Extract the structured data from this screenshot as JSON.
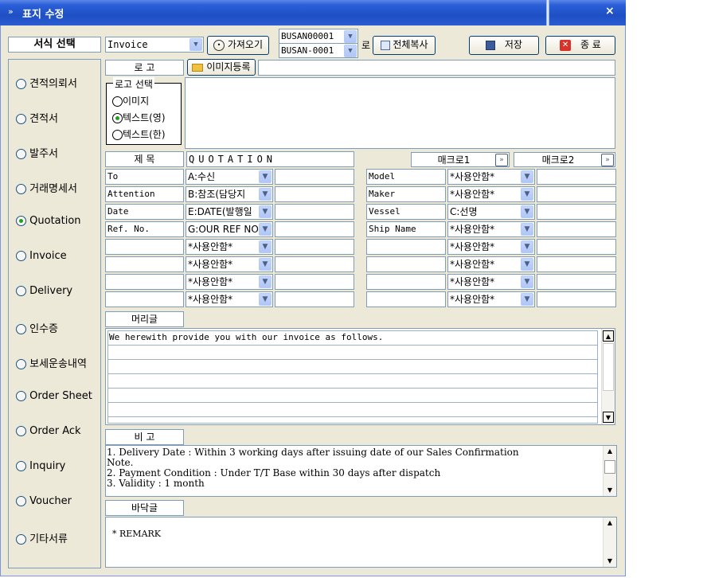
{
  "window": {
    "title": "표지 수정",
    "close": "×",
    "title_icon": "»"
  },
  "top": {
    "format_label": "서식 선택",
    "format_value": "Invoice",
    "import_button": "가져오기",
    "source_code_1": "BUSAN00001",
    "source_code_2": "BUSAN-0001",
    "to_label": "로",
    "copy_all_button": "전체복사",
    "save_button": "저장",
    "exit_button": "종 료"
  },
  "sidebar": {
    "items": [
      {
        "label": "견적의뢰서",
        "selected": false
      },
      {
        "label": "견적서",
        "selected": false
      },
      {
        "label": "발주서",
        "selected": false
      },
      {
        "label": "거래명세서",
        "selected": false
      },
      {
        "label": "Quotation",
        "selected": true
      },
      {
        "label": "Invoice",
        "selected": false
      },
      {
        "label": "Delivery",
        "selected": false
      },
      {
        "label": "인수증",
        "selected": false
      },
      {
        "label": "보세운송내역",
        "selected": false
      },
      {
        "label": "Order Sheet",
        "selected": false
      },
      {
        "label": "Order Ack",
        "selected": false
      },
      {
        "label": "Inquiry",
        "selected": false
      },
      {
        "label": "Voucher",
        "selected": false
      },
      {
        "label": "기타서류",
        "selected": false
      }
    ]
  },
  "logo": {
    "label": "로 고",
    "register_button": "이미지등록",
    "path_value": "",
    "select_group_label": "로고 선택",
    "options": [
      {
        "label": "이미지",
        "selected": false
      },
      {
        "label": "텍스트(영)",
        "selected": true
      },
      {
        "label": "텍스트(한)",
        "selected": false
      }
    ]
  },
  "subject": {
    "label": "제 목",
    "value": "QUOTATION",
    "macro1": "매크로1",
    "macro2": "매크로2"
  },
  "left_rows": [
    {
      "label": "To",
      "combo": "A:수신",
      "value": ""
    },
    {
      "label": "Attention",
      "combo": "B:참조(담당지",
      "value": ""
    },
    {
      "label": "Date",
      "combo": "E:DATE(발행일",
      "value": ""
    },
    {
      "label": "Ref. No.",
      "combo": "G:OUR REF NO",
      "value": ""
    },
    {
      "label": "",
      "combo": "*사용안함*",
      "value": ""
    },
    {
      "label": "",
      "combo": "*사용안함*",
      "value": ""
    },
    {
      "label": "",
      "combo": "*사용안함*",
      "value": ""
    },
    {
      "label": "",
      "combo": "*사용안함*",
      "value": ""
    }
  ],
  "right_rows": [
    {
      "label": "Model",
      "combo": "*사용안함*",
      "value": ""
    },
    {
      "label": "Maker",
      "combo": "*사용안함*",
      "value": ""
    },
    {
      "label": "Vessel",
      "combo": "C:선명",
      "value": ""
    },
    {
      "label": "Ship Name",
      "combo": "*사용안함*",
      "value": ""
    },
    {
      "label": "",
      "combo": "*사용안함*",
      "value": ""
    },
    {
      "label": "",
      "combo": "*사용안함*",
      "value": ""
    },
    {
      "label": "",
      "combo": "*사용안함*",
      "value": ""
    },
    {
      "label": "",
      "combo": "*사용안함*",
      "value": ""
    }
  ],
  "header_text": {
    "label": "머리글",
    "line1": "We herewith provide you with our invoice as follows."
  },
  "remarks": {
    "label": "비 고",
    "line1": "1. Delivery Date : Within 3 working days after issuing date of our Sales Confirmation",
    "line2": "Note.",
    "line3": "2. Payment Condition : Under T/T Base within 30 days after dispatch",
    "line4": "3. Validity : 1 month"
  },
  "footer_text": {
    "label": "바닥글",
    "line1": "* REMARK"
  }
}
